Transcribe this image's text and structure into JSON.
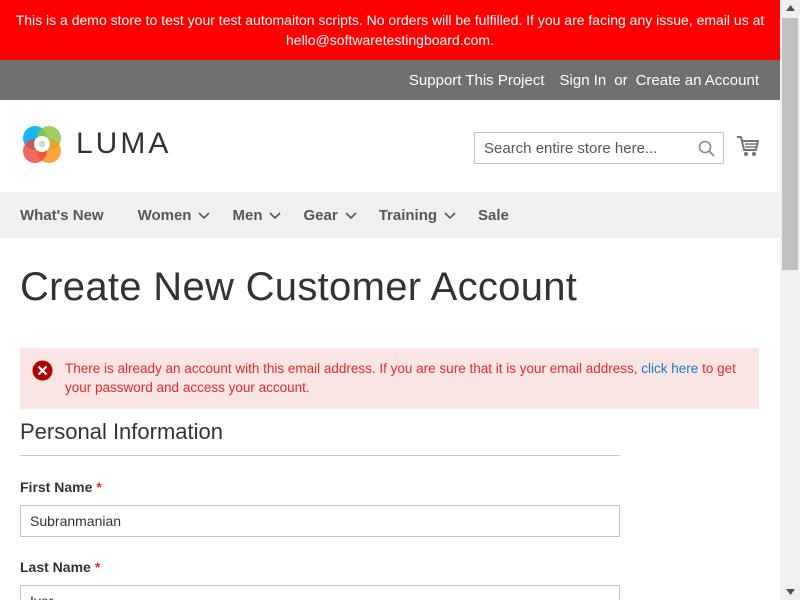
{
  "banner": {
    "text": "This is a demo store to test your test automaiton scripts. No orders will be fulfilled. If you are facing any issue, email us at hello@softwaretestingboard.com."
  },
  "top_links": {
    "support": "Support This Project",
    "sign_in": "Sign In",
    "or": "or",
    "create_account": "Create an Account"
  },
  "header": {
    "logo_text": "LUMA",
    "search_placeholder": "Search entire store here...",
    "icons": [
      "luma-logo-icon",
      "search-icon",
      "cart-icon"
    ]
  },
  "nav": {
    "items": [
      {
        "label": "What's New",
        "has_dropdown": false
      },
      {
        "label": "Women",
        "has_dropdown": true
      },
      {
        "label": "Men",
        "has_dropdown": true
      },
      {
        "label": "Gear",
        "has_dropdown": true
      },
      {
        "label": "Training",
        "has_dropdown": true
      },
      {
        "label": "Sale",
        "has_dropdown": false
      }
    ]
  },
  "main": {
    "title": "Create New Customer Account",
    "error": {
      "text_before": "There is already an account with this email address. If you are sure that it is your email address, ",
      "link": "click here",
      "text_after": " to get your password and access your account."
    },
    "personal_info": {
      "legend": "Personal Information",
      "first_name": {
        "label": "First Name",
        "required": "*",
        "value": "Subranmanian"
      },
      "last_name": {
        "label": "Last Name",
        "required": "*",
        "value": "Iyer"
      }
    }
  },
  "colors": {
    "banner_bg": "#ff0000",
    "top_bar_bg": "#6e716e",
    "nav_bg": "#f0f0f0",
    "error_bg": "#fae5e5",
    "error_text": "#e02b27",
    "link": "#1979c3"
  }
}
